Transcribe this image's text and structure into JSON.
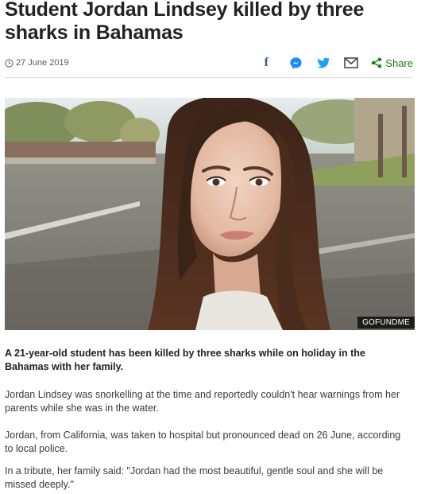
{
  "article": {
    "headline": "Student Jordan Lindsey killed by three sharks in Bahamas",
    "date": "27 June 2019",
    "share_label": "Share",
    "share_icons": [
      "facebook-icon",
      "messenger-icon",
      "twitter-icon",
      "email-icon",
      "share-icon"
    ],
    "image_credit": "GOFUNDME",
    "paragraphs": [
      "A 21-year-old student has been killed by three sharks while on holiday in the Bahamas with her family.",
      "Jordan Lindsey was snorkelling at the time and reportedly couldn't hear warnings from her parents while she was in the water.",
      "Jordan, from California, was taken to hospital but pronounced dead on 26 June, according to local police.",
      "In a tribute, her family said: \"Jordan had the most beautiful, gentle soul and she will be missed deeply.\""
    ]
  },
  "colors": {
    "facebook": "#3b5998",
    "messenger": "#1a8cff",
    "twitter": "#1da1f2",
    "share_green": "#1a7a1a",
    "text": "#222222"
  }
}
